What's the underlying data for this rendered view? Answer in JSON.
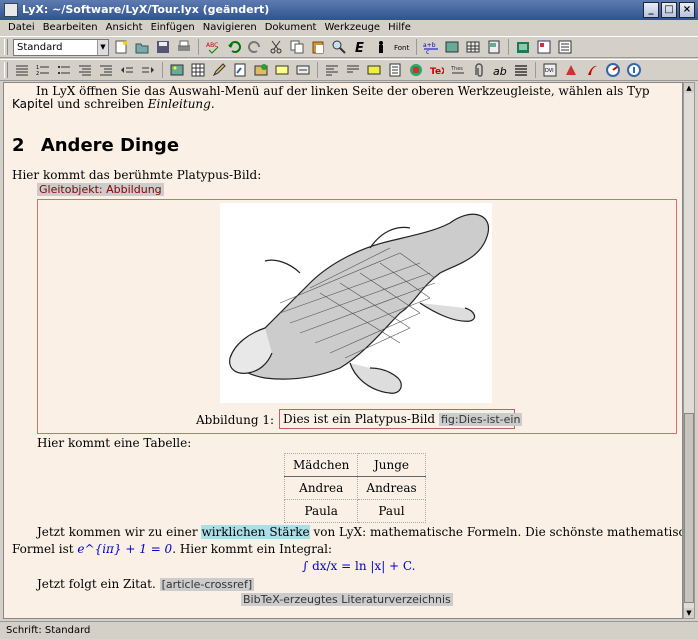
{
  "window": {
    "title": "LyX: ~/Software/LyX/Tour.lyx (geändert)",
    "btn_min": "_",
    "btn_max": "□",
    "btn_close": "×"
  },
  "menubar": [
    "Datei",
    "Bearbeiten",
    "Ansicht",
    "Einfügen",
    "Navigieren",
    "Dokument",
    "Werkzeuge",
    "Hilfe"
  ],
  "toolbar": {
    "style_combo": "Standard",
    "combo_arrow": "▼"
  },
  "document": {
    "para_top_line1": "In LyX öffnen Sie das Auswahl-Menü auf der linken Seite der oberen Werkzeugleiste, wählen als Typ",
    "para_top_kapitel": "Kapitel",
    "para_top_mid": " und schreiben ",
    "para_top_einleitung": "Einleitung",
    "para_top_end": ".",
    "section_number": "2",
    "section_title": "Andere Dinge",
    "platypus_intro": "Hier kommt das berühmte Platypus-Bild:",
    "float_label": "Gleitobjekt: Abbildung",
    "caption_prefix": "Abbildung 1:",
    "caption_text": "Dies ist ein Platypus-Bild",
    "caption_label": "fig:Dies-ist-ein",
    "table_intro": "Hier kommt eine Tabelle:",
    "table": [
      [
        "Mädchen",
        "Junge"
      ],
      [
        "Andrea",
        "Andreas"
      ],
      [
        "Paula",
        "Paul"
      ]
    ],
    "math_p1_a": "Jetzt kommen wir zu einer ",
    "math_p1_highlight": "wirklichen Stärke",
    "math_p1_b": " von LyX: mathematische Formeln. Die schönste mathematische",
    "math_p2_a": "Formel ist ",
    "math_formula": "e^{iπ} + 1 = 0",
    "math_p2_b": ". Hier kommt ein Integral:",
    "integral": "∫ dx/x = ln |x| + C.",
    "zitat_text": "Jetzt folgt ein Zitat. ",
    "zitat_ref": "[article-crossref]",
    "bibtex": "BibTeX-erzeugtes Literaturverzeichnis"
  },
  "statusbar": "Schrift: Standard",
  "scrollbar": {
    "up": "▲",
    "down": "▼"
  }
}
